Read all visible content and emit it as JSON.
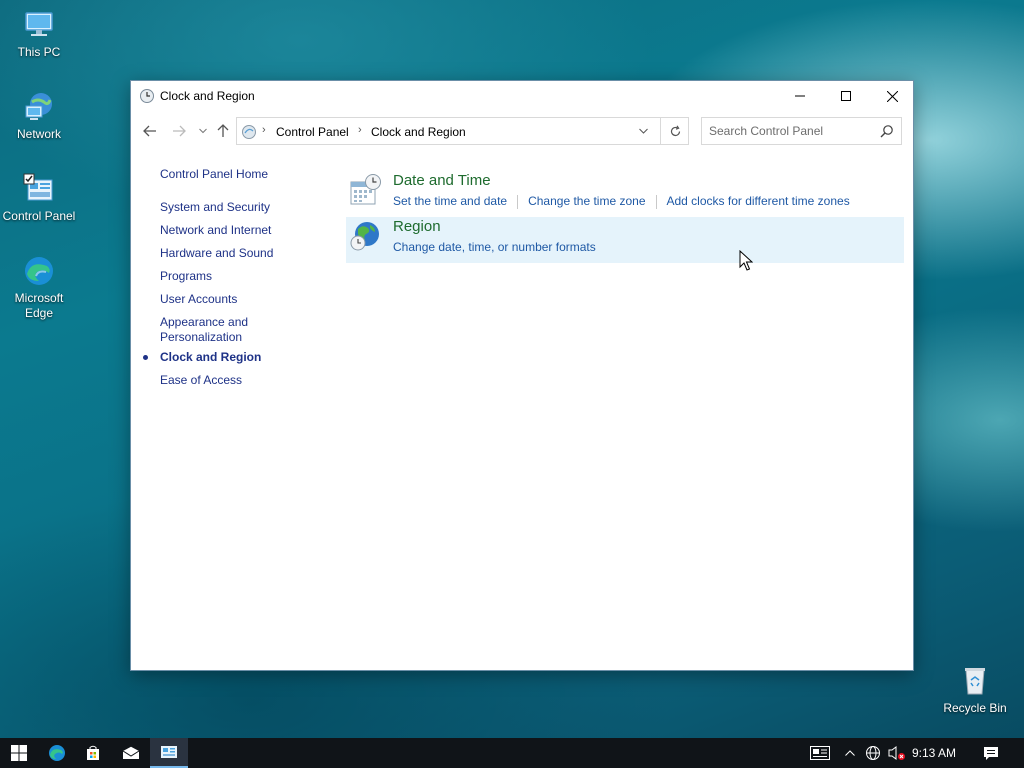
{
  "desktop": {
    "icons": [
      {
        "label": "This PC",
        "icon": "this-pc-icon"
      },
      {
        "label": "Network",
        "icon": "network-icon"
      },
      {
        "label": "Control Panel",
        "icon": "control-panel-icon"
      },
      {
        "label": "Microsoft Edge",
        "icon": "edge-icon"
      },
      {
        "label": "Recycle Bin",
        "icon": "recycle-bin-icon"
      }
    ]
  },
  "window": {
    "title": "Clock and Region",
    "address": {
      "crumbs": [
        "Control Panel",
        "Clock and Region"
      ]
    },
    "search": {
      "placeholder": "Search Control Panel"
    },
    "leftnav": {
      "home": "Control Panel Home",
      "categories": [
        "System and Security",
        "Network and Internet",
        "Hardware and Sound",
        "Programs",
        "User Accounts",
        "Appearance and Personalization",
        "Clock and Region",
        "Ease of Access"
      ],
      "appearance_line1": "Appearance and",
      "appearance_line2": "Personalization",
      "active": "Clock and Region"
    },
    "items": [
      {
        "heading": "Date and Time",
        "icon": "date-and-time-icon",
        "links": [
          "Set the time and date",
          "Change the time zone",
          "Add clocks for different time zones"
        ]
      },
      {
        "heading": "Region",
        "icon": "region-globe-icon",
        "links": [
          "Change date, time, or number formats"
        ]
      }
    ]
  },
  "taskbar": {
    "clock": "9:13 AM",
    "colors": {
      "taskbar_bg": "#101418",
      "accent": "#76b9ed"
    }
  },
  "colors": {
    "link": "#1f59a5",
    "heading": "#1e6b2e",
    "nav_link": "#1e3287",
    "hover": "#e5f3fb"
  }
}
